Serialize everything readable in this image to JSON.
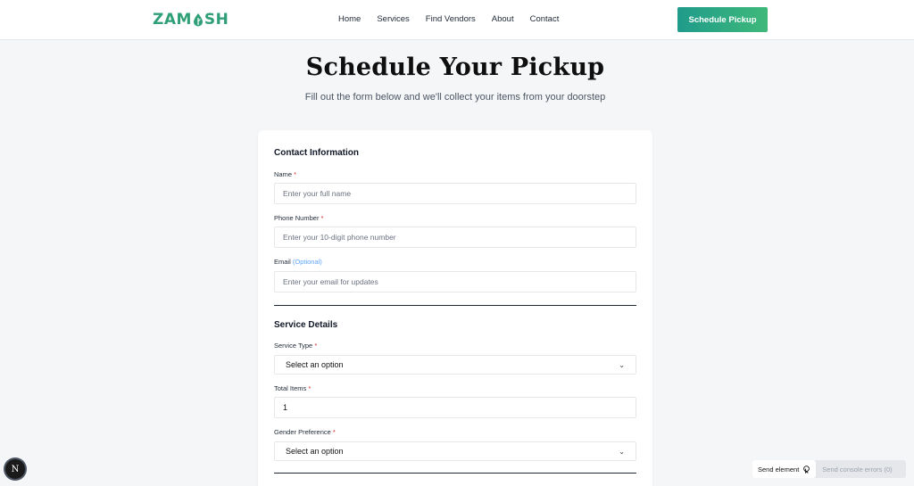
{
  "brand": {
    "name_left": "ZAM",
    "name_right": "SH",
    "accent": "#2f9f78"
  },
  "nav": {
    "links": [
      "Home",
      "Services",
      "Find Vendors",
      "About",
      "Contact"
    ],
    "cta_label": "Schedule Pickup"
  },
  "hero": {
    "title": "Schedule Your Pickup",
    "subtitle": "Fill out the form below and we'll collect your items from your doorstep"
  },
  "contact": {
    "section_title": "Contact Information",
    "name_label": "Name",
    "name_placeholder": "Enter your full name",
    "phone_label": "Phone Number",
    "phone_placeholder": "Enter your 10-digit phone number",
    "email_label": "Email",
    "email_optional": "(Optional)",
    "email_placeholder": "Enter your email for updates",
    "required_mark": "*"
  },
  "service": {
    "section_title": "Service Details",
    "type_label": "Service Type",
    "type_value": "Select an option",
    "items_label": "Total Items",
    "items_value": "1",
    "gender_label": "Gender Preference",
    "gender_value": "Select an option"
  },
  "devtools": {
    "badge": "N",
    "send_element": "Send element",
    "send_errors": "Send console errors (0)"
  },
  "colors": {
    "cta_start": "#1f9b8b",
    "cta_end": "#3fb97a",
    "required": "#dc2626",
    "optional": "#60a5fa"
  }
}
